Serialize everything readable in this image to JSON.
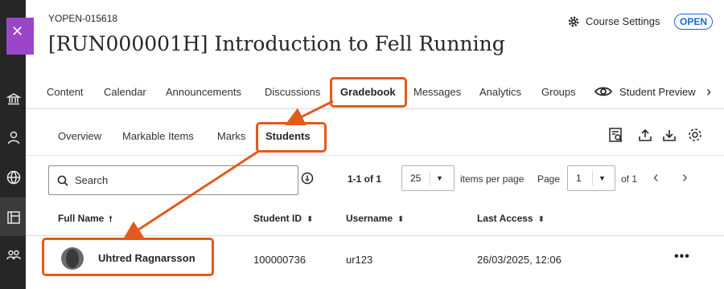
{
  "course": {
    "id": "YOPEN-015618",
    "title": "[RUN000001H] Introduction to Fell Running",
    "settings_label": "Course Settings",
    "status_badge": "OPEN"
  },
  "nav_rail": {
    "icons": [
      "close-icon",
      "institution-icon",
      "profile-icon",
      "globe-icon",
      "courses-icon",
      "groups-icon"
    ]
  },
  "tabs": [
    {
      "label": "Content"
    },
    {
      "label": "Calendar"
    },
    {
      "label": "Announcements"
    },
    {
      "label": "Discussions"
    },
    {
      "label": "Gradebook",
      "active": true
    },
    {
      "label": "Messages"
    },
    {
      "label": "Analytics"
    },
    {
      "label": "Groups"
    }
  ],
  "student_preview_label": "Student Preview",
  "subtabs": [
    {
      "label": "Overview"
    },
    {
      "label": "Markable Items"
    },
    {
      "label": "Marks"
    },
    {
      "label": "Students",
      "active": true
    }
  ],
  "toolbar_icons": [
    "search-list-icon",
    "upload-icon",
    "download-icon",
    "settings-gear-icon"
  ],
  "search": {
    "placeholder": "Search"
  },
  "pagination": {
    "count": "1-1 of 1",
    "per_page_value": "25",
    "per_page_label": "items per page",
    "page_label": "Page",
    "page_value": "1",
    "of_pages": "of 1"
  },
  "table": {
    "columns": [
      "Full Name",
      "Student ID",
      "Username",
      "Last Access"
    ],
    "rows": [
      {
        "name": "Uhtred Ragnarsson",
        "student_id": "100000736",
        "username": "ur123",
        "last_access": "26/03/2025, 12:06",
        "actions": "•••"
      }
    ]
  },
  "colors": {
    "accent": "#1a69d6",
    "annotation": "#e35a1c",
    "rail": "#262626",
    "close_tab": "#9b45c9"
  }
}
